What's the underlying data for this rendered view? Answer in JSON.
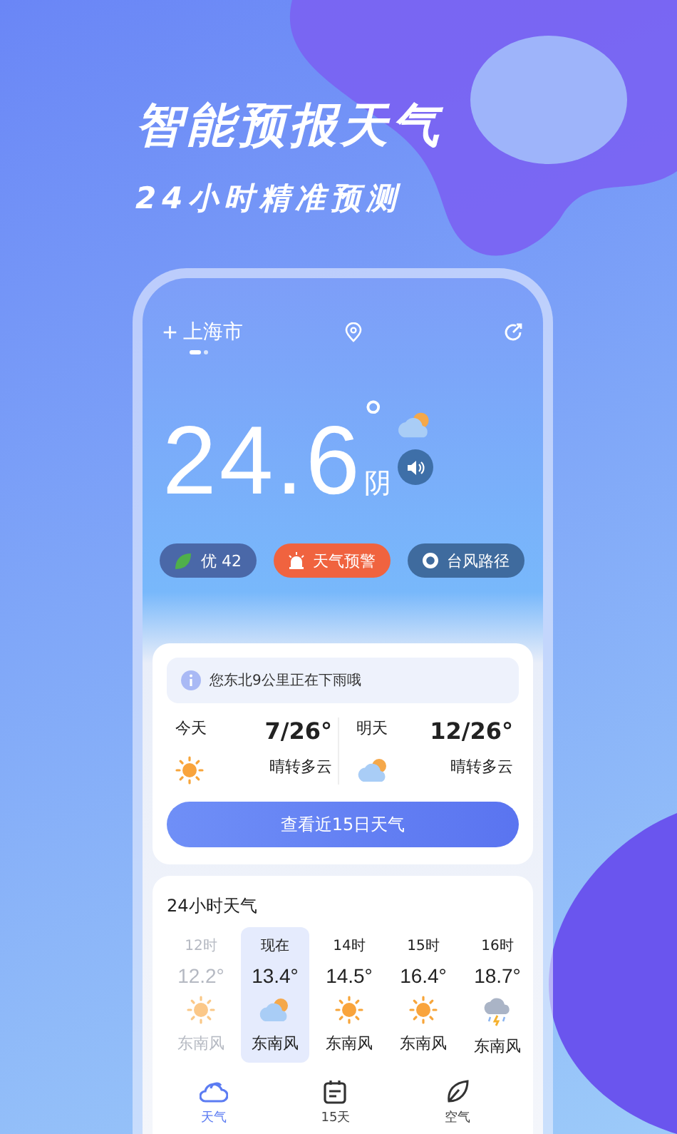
{
  "promo": {
    "title": "智能预报天气",
    "subtitle": "24小时精准预测"
  },
  "header": {
    "add": "+",
    "city": "上海市"
  },
  "now": {
    "temp": "24.6",
    "unit": "°",
    "condition": "阴"
  },
  "badges": [
    {
      "kind": "aqi",
      "label": "优 42"
    },
    {
      "kind": "warning",
      "label": "天气预警"
    },
    {
      "kind": "typhoon",
      "label": "台风路径"
    }
  ],
  "notice": "您东北9公里正在下雨哦",
  "days": [
    {
      "label": "今天",
      "kind": "sun",
      "range": "7/26°",
      "desc": "晴转多云"
    },
    {
      "label": "明天",
      "kind": "cloudy",
      "range": "12/26°",
      "desc": "晴转多云"
    }
  ],
  "forecast_button": "查看近15日天气",
  "hourly": {
    "title": "24小时天气",
    "hours": [
      {
        "time": "12时",
        "temp": "12.2°",
        "kind": "sun",
        "wind": "东南风",
        "past": true,
        "selected": false
      },
      {
        "time": "现在",
        "temp": "13.4°",
        "kind": "cloudy",
        "wind": "东南风",
        "past": false,
        "selected": true
      },
      {
        "time": "14时",
        "temp": "14.5°",
        "kind": "sun",
        "wind": "东南风",
        "past": false,
        "selected": false
      },
      {
        "time": "15时",
        "temp": "16.4°",
        "kind": "sun",
        "wind": "东南风",
        "past": false,
        "selected": false
      },
      {
        "time": "16时",
        "temp": "18.7°",
        "kind": "storm",
        "wind": "东南风",
        "past": false,
        "selected": false
      }
    ]
  },
  "tabs": [
    {
      "kind": "weather",
      "label": "天气",
      "selected": true
    },
    {
      "kind": "calendar",
      "label": "15天",
      "selected": false
    },
    {
      "kind": "leaf",
      "label": "空气",
      "selected": false
    }
  ]
}
